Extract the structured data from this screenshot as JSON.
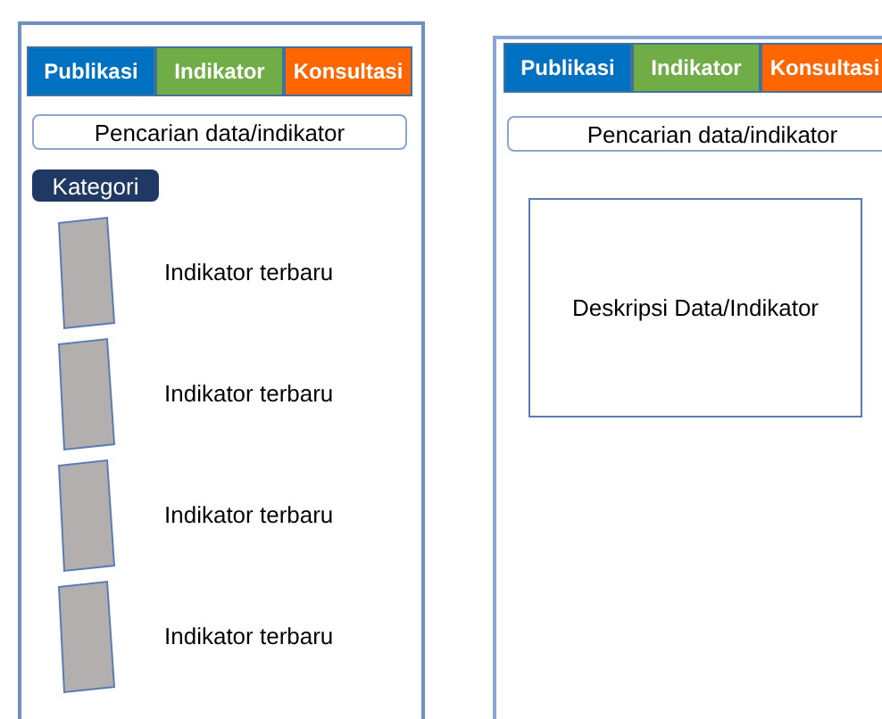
{
  "screens": [
    {
      "tabs": [
        {
          "label": "Publikasi",
          "color": "#0070c0"
        },
        {
          "label": "Indikator",
          "color": "#70ad47"
        },
        {
          "label": "Konsultasi",
          "color": "#ff6600"
        }
      ],
      "search": {
        "placeholder": "Pencarian data/indikator"
      },
      "category_button": "Kategori",
      "items": [
        {
          "label": "Indikator terbaru"
        },
        {
          "label": "Indikator terbaru"
        },
        {
          "label": "Indikator terbaru"
        },
        {
          "label": "Indikator terbaru"
        }
      ]
    },
    {
      "tabs": [
        {
          "label": "Publikasi",
          "color": "#0070c0"
        },
        {
          "label": "Indikator",
          "color": "#70ad47"
        },
        {
          "label": "Konsultasi",
          "color": "#ff6600"
        }
      ],
      "search": {
        "placeholder": "Pencarian data/indikator"
      },
      "description_box": "Deskripsi Data/Indikator"
    }
  ]
}
